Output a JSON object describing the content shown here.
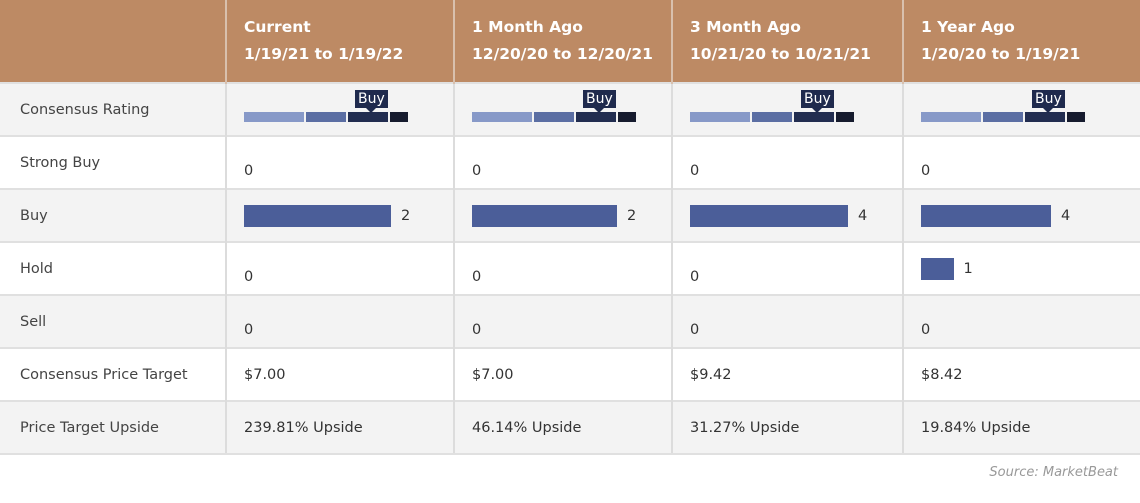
{
  "chart_data": {
    "type": "table",
    "columns": [
      {
        "title": "Current",
        "range": "1/19/21 to 1/19/22",
        "consensus": "Buy",
        "strong_buy": 0,
        "buy": 2,
        "hold": 0,
        "sell": 0,
        "price_target": "$7.00",
        "upside": "239.81% Upside"
      },
      {
        "title": "1 Month Ago",
        "range": "12/20/20 to 12/20/21",
        "consensus": "Buy",
        "strong_buy": 0,
        "buy": 2,
        "hold": 0,
        "sell": 0,
        "price_target": "$7.00",
        "upside": "46.14% Upside"
      },
      {
        "title": "3 Month Ago",
        "range": "10/21/20 to 10/21/21",
        "consensus": "Buy",
        "strong_buy": 0,
        "buy": 4,
        "hold": 0,
        "sell": 0,
        "price_target": "$9.42",
        "upside": "31.27% Upside"
      },
      {
        "title": "1 Year Ago",
        "range": "1/20/20 to 1/19/21",
        "consensus": "Buy",
        "strong_buy": 0,
        "buy": 4,
        "hold": 1,
        "sell": 0,
        "price_target": "$8.42",
        "upside": "19.84% Upside"
      }
    ],
    "row_labels": {
      "consensus": "Consensus Rating",
      "strong_buy": "Strong Buy",
      "buy": "Buy",
      "hold": "Hold",
      "sell": "Sell",
      "price_target": "Consensus Price Target",
      "upside": "Price Target Upside"
    },
    "rating_scale_colors": [
      "#8799c8",
      "#5b6ea3",
      "#222d50",
      "#161b2e"
    ],
    "bar_color": "#4b5e99",
    "header_color": "#bd8a64"
  },
  "source": "Source: MarketBeat"
}
